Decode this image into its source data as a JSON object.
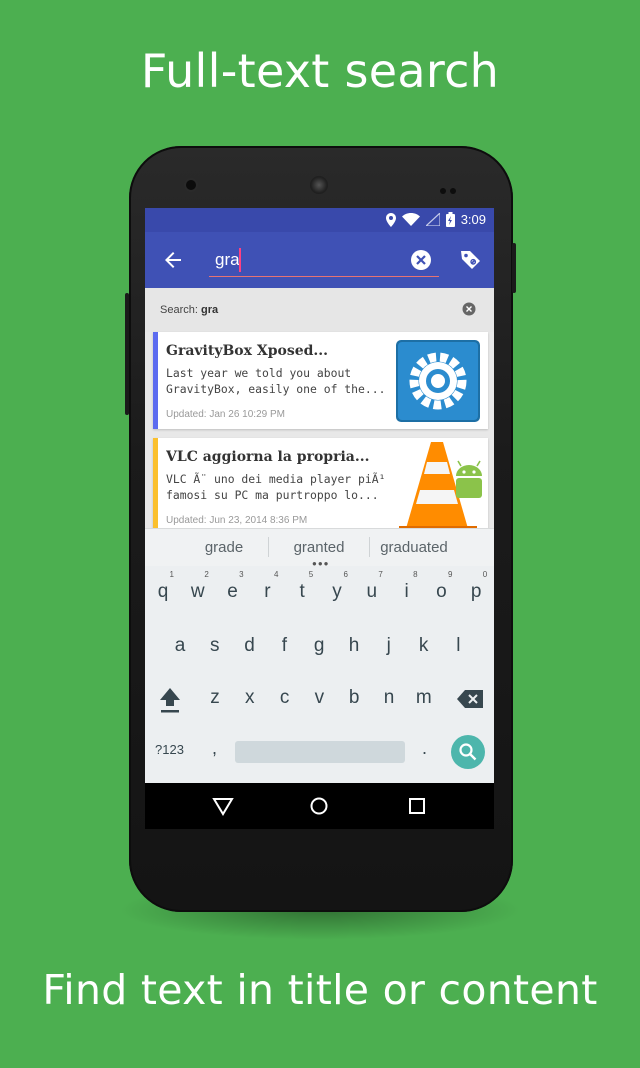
{
  "promo": {
    "headline": "Full-text search",
    "caption": "Find text in title or content"
  },
  "statusbar": {
    "time": "3:09"
  },
  "toolbar": {
    "search_value": "gra",
    "back_icon": "arrow-back-icon",
    "clear_icon": "clear-circle-icon",
    "tag_icon": "tag-icon"
  },
  "filter": {
    "label": "Search:",
    "term": "gra"
  },
  "articles": [
    {
      "title": "GravityBox Xposed...",
      "excerpt_line1": "Last year we told you about",
      "excerpt_line2": "GravityBox, easily one of the...",
      "updated": "Updated: Jan 26 10:29 PM",
      "accent": "#5c6bf0"
    },
    {
      "title": "VLC aggiorna la propria...",
      "excerpt_line1": "VLC Ã¨ uno dei media player piÃ¹",
      "excerpt_line2": "famosi su PC ma purtroppo lo...",
      "updated": "Updated: Jun 23, 2014 8:36 PM",
      "accent": "#fbc02d"
    }
  ],
  "suggestions": [
    "grade",
    "granted",
    "graduated"
  ],
  "keyboard": {
    "row1": [
      "q",
      "w",
      "e",
      "r",
      "t",
      "y",
      "u",
      "i",
      "o",
      "p"
    ],
    "row1_hints": [
      "1",
      "2",
      "3",
      "4",
      "5",
      "6",
      "7",
      "8",
      "9",
      "0"
    ],
    "row2": [
      "a",
      "s",
      "d",
      "f",
      "g",
      "h",
      "j",
      "k",
      "l"
    ],
    "row3": [
      "z",
      "x",
      "c",
      "v",
      "b",
      "n",
      "m"
    ],
    "sym_label": "?123",
    "comma": ",",
    "period": "."
  },
  "colors": {
    "background": "#4caf50",
    "toolbar": "#3f51b5",
    "statusbar": "#3949ab",
    "search_key": "#4db6ac"
  }
}
